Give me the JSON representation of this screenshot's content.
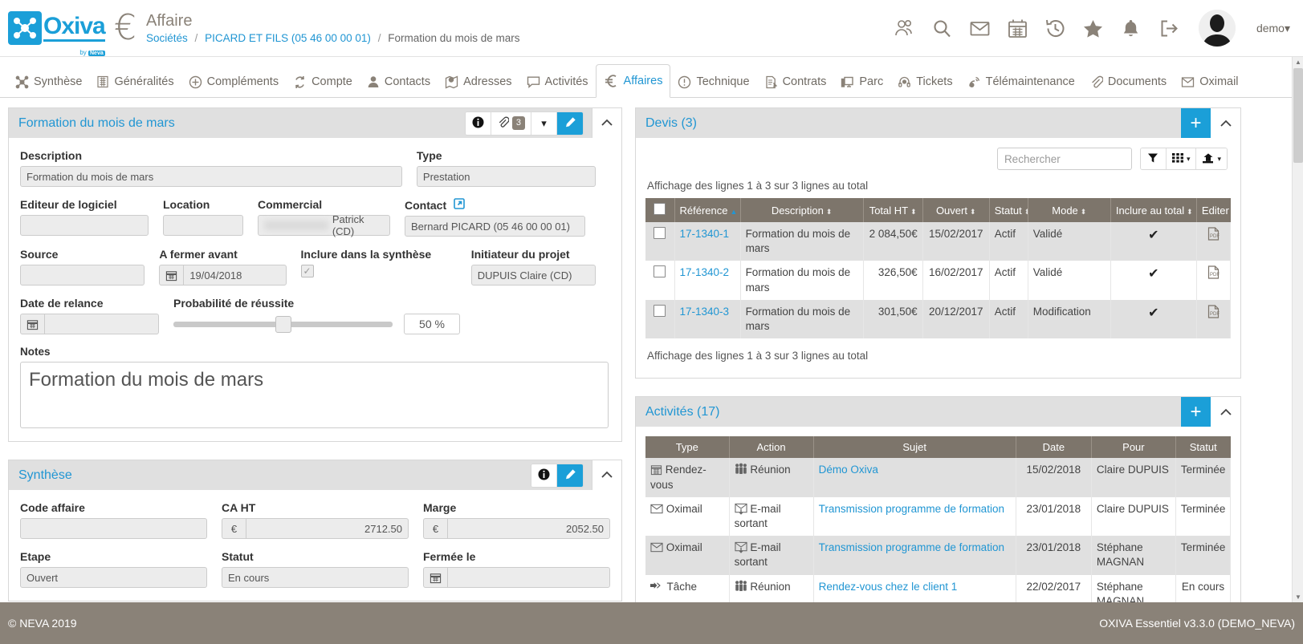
{
  "brand": {
    "logo_text": "Oxiva",
    "logo_sub_prefix": "by",
    "logo_sub_name": "Neva",
    "accent": "#1b9fd8",
    "header_brown": "#8a8278",
    "table_header": "#7d756b"
  },
  "header": {
    "module_icon": "euro-icon",
    "module_title": "Affaire",
    "breadcrumb": [
      {
        "label": "Sociétés",
        "link": true
      },
      {
        "label": "PICARD ET FILS (05 46 00 00 01)",
        "link": true
      },
      {
        "label": "Formation du mois de mars",
        "link": false
      }
    ],
    "icons": [
      "users-icon",
      "search-icon",
      "envelope-icon",
      "calendar-icon",
      "history-icon",
      "star-icon",
      "bell-icon",
      "logout-icon"
    ],
    "user_label": "demo",
    "user_caret": "▾"
  },
  "nav": {
    "tabs": [
      {
        "label": "Synthèse",
        "icon": "synthese-icon",
        "active": false
      },
      {
        "label": "Généralités",
        "icon": "building-icon",
        "active": false
      },
      {
        "label": "Compléments",
        "icon": "plus-circle-icon",
        "active": false
      },
      {
        "label": "Compte",
        "icon": "sync-icon",
        "active": false
      },
      {
        "label": "Contacts",
        "icon": "person-icon",
        "active": false
      },
      {
        "label": "Adresses",
        "icon": "map-pin-icon",
        "active": false
      },
      {
        "label": "Activités",
        "icon": "speech-bubble-icon",
        "active": false
      },
      {
        "label": "Affaires",
        "icon": "euro-icon",
        "active": true
      },
      {
        "label": "Technique",
        "icon": "exclamation-circle-icon",
        "active": false
      },
      {
        "label": "Contrats",
        "icon": "document-pen-icon",
        "active": false
      },
      {
        "label": "Parc",
        "icon": "monitor-icon",
        "active": false
      },
      {
        "label": "Tickets",
        "icon": "headset-icon",
        "active": false
      },
      {
        "label": "Télémaintenance",
        "icon": "remote-support-icon",
        "active": false
      },
      {
        "label": "Documents",
        "icon": "paperclip-icon",
        "active": false
      },
      {
        "label": "Oximail",
        "icon": "envelope-icon",
        "active": false
      }
    ]
  },
  "affaire_panel": {
    "title": "Formation du mois de mars",
    "tools": {
      "info_icon": "info-icon",
      "attach_icon": "paperclip-icon",
      "attach_count": "3",
      "caret_icon": "▾",
      "edit_icon": "pencil-icon",
      "collapse_icon": "chevron-up-icon"
    },
    "fields": {
      "description_label": "Description",
      "description_value": "Formation du mois de mars",
      "type_label": "Type",
      "type_value": "Prestation",
      "editeur_label": "Editeur de logiciel",
      "editeur_value": "",
      "location_label": "Location",
      "location_value": "",
      "commercial_label": "Commercial",
      "commercial_value": "Patrick (CD)",
      "contact_label": "Contact",
      "contact_value": "Bernard PICARD (05 46 00 00 01)",
      "contact_ext_icon": "external-link-icon",
      "source_label": "Source",
      "source_value": "",
      "fermer_label": "A fermer avant",
      "fermer_value": "19/04/2018",
      "inclure_label": "Inclure dans la synthèse",
      "inclure_checked": "✓",
      "initiateur_label": "Initiateur du projet",
      "initiateur_value": "DUPUIS Claire (CD)",
      "relance_label": "Date de relance",
      "relance_value": "",
      "proba_label": "Probabilité de réussite",
      "proba_value": "50 %",
      "proba_percent": 50,
      "notes_label": "Notes",
      "notes_value": "Formation du mois de mars"
    }
  },
  "synthese_panel": {
    "title": "Synthèse",
    "tools": {
      "info_icon": "info-icon",
      "edit_icon": "pencil-icon",
      "collapse_icon": "chevron-up-icon"
    },
    "fields": {
      "code_label": "Code affaire",
      "code_value": "",
      "ca_label": "CA HT",
      "ca_currency": "€",
      "ca_value": "2712.50",
      "marge_label": "Marge",
      "marge_currency": "€",
      "marge_value": "2052.50",
      "etape_label": "Etape",
      "etape_value": "Ouvert",
      "statut_label": "Statut",
      "statut_value": "En cours",
      "fermee_label": "Fermée le",
      "fermee_value": ""
    }
  },
  "devis_panel": {
    "title": "Devis (3)",
    "add_icon": "plus-icon",
    "collapse_icon": "chevron-up-icon",
    "search_placeholder": "Rechercher",
    "toolbar_icons": [
      "filter-icon",
      "columns-icon",
      "export-icon"
    ],
    "info_top": "Affichage des lignes 1 à 3 sur 3 lignes au total",
    "info_bottom": "Affichage des lignes 1 à 3 sur 3 lignes au total",
    "columns": [
      "",
      "Référence",
      "Description",
      "Total HT",
      "Ouvert",
      "Statut",
      "Mode",
      "Inclure au total",
      "Editer"
    ],
    "rows": [
      {
        "reference": "17-1340-1",
        "description": "Formation du mois de mars",
        "total_ht": "2 084,50€",
        "ouvert": "15/02/2017",
        "statut": "Actif",
        "mode": "Validé",
        "inclure": "✔",
        "editer_icon": "pdf-icon"
      },
      {
        "reference": "17-1340-2",
        "description": "Formation du mois de mars",
        "total_ht": "326,50€",
        "ouvert": "16/02/2017",
        "statut": "Actif",
        "mode": "Validé",
        "inclure": "✔",
        "editer_icon": "pdf-icon"
      },
      {
        "reference": "17-1340-3",
        "description": "Formation du mois de mars",
        "total_ht": "301,50€",
        "ouvert": "20/12/2017",
        "statut": "Actif",
        "mode": "Modification",
        "inclure": "✔",
        "editer_icon": "pdf-icon"
      }
    ]
  },
  "activites_panel": {
    "title": "Activités (17)",
    "add_icon": "plus-icon",
    "collapse_icon": "chevron-up-icon",
    "columns": [
      "Type",
      "Action",
      "Sujet",
      "Date",
      "Pour",
      "Statut"
    ],
    "rows": [
      {
        "type": "Rendez-vous",
        "type_icon": "appointment-icon",
        "action": "Réunion",
        "action_icon": "people-icon",
        "sujet": "Démo Oxiva",
        "date": "15/02/2018",
        "pour": "Claire DUPUIS",
        "statut": "Terminée"
      },
      {
        "type": "Oximail",
        "type_icon": "envelope-icon",
        "action": "E-mail sortant",
        "action_icon": "envelope-out-icon",
        "sujet": "Transmission programme de formation",
        "date": "23/01/2018",
        "pour": "Claire DUPUIS",
        "statut": "Terminée"
      },
      {
        "type": "Oximail",
        "type_icon": "envelope-icon",
        "action": "E-mail sortant",
        "action_icon": "envelope-out-icon",
        "sujet": "Transmission programme de formation",
        "date": "23/01/2018",
        "pour": "Stéphane MAGNAN",
        "statut": "Terminée"
      },
      {
        "type": "Tâche",
        "type_icon": "task-arrow-icon",
        "action": "Réunion",
        "action_icon": "people-icon",
        "sujet": "Rendez-vous chez le client 1",
        "date": "22/02/2017",
        "pour": "Stéphane MAGNAN",
        "statut": "En cours"
      }
    ]
  },
  "footer": {
    "left": "© NEVA 2019",
    "right": "OXIVA Essentiel v3.3.0 (DEMO_NEVA)"
  }
}
